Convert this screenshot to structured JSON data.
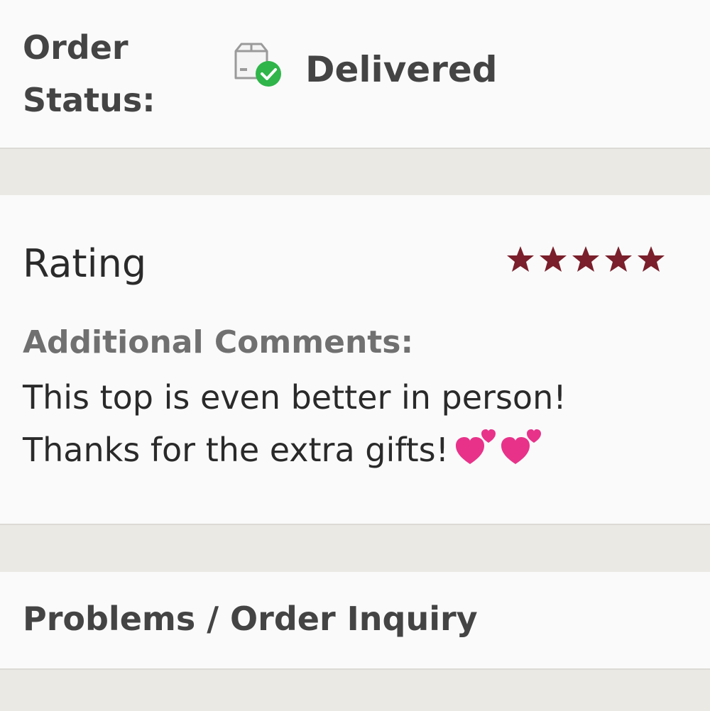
{
  "order_status": {
    "label": "Order Status:",
    "value": "Delivered",
    "icon": "package-delivered-icon",
    "status_color": "#2fb54a"
  },
  "rating": {
    "label": "Rating",
    "stars": 5,
    "max_stars": 5,
    "star_color": "#7a1f2b"
  },
  "comments": {
    "label": "Additional Comments:",
    "text": "This top is even better in person! Thanks for the extra gifts!",
    "emoji": "two-hearts-icon"
  },
  "problems": {
    "label": "Problems / Order Inquiry"
  }
}
